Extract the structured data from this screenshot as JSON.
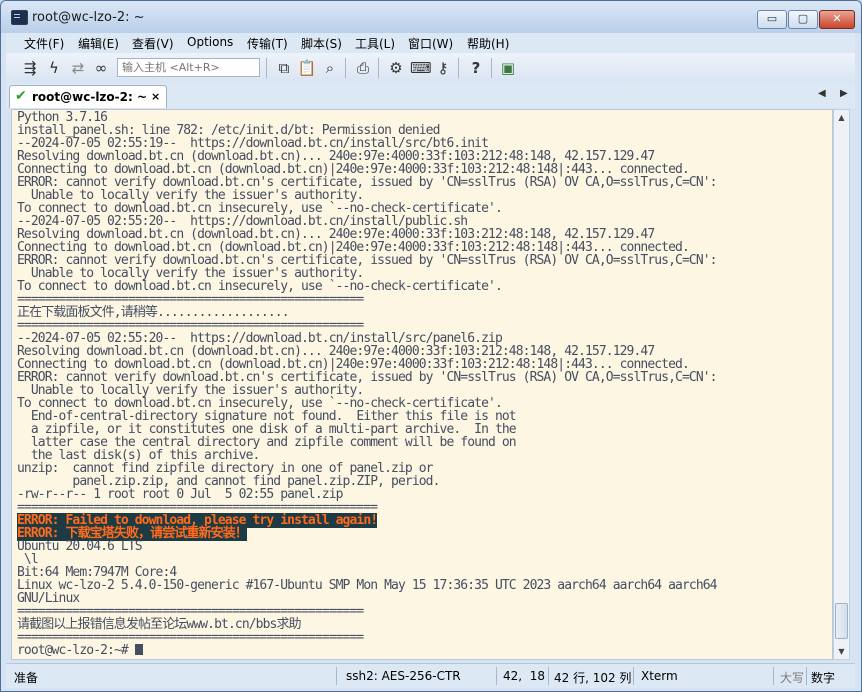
{
  "window": {
    "title": "root@wc-lzo-2: ~",
    "controls": {
      "minimize": "▭",
      "maximize": "▢",
      "close": "✕"
    }
  },
  "menubar": {
    "items": [
      "文件(F)",
      "编辑(E)",
      "查看(V)",
      "Options",
      "传输(T)",
      "脚本(S)",
      "工具(L)",
      "窗口(W)",
      "帮助(H)"
    ]
  },
  "toolbar": {
    "host_placeholder": "输入主机 <Alt+R>",
    "icons": [
      "connect-icon",
      "lightning-icon",
      "reconnect-icon",
      "link-icon",
      "copy-icon",
      "paste-icon",
      "find-icon",
      "print-icon",
      "settings-icon",
      "keymap-icon",
      "key-icon",
      "help-icon",
      "sftp-icon"
    ]
  },
  "tab": {
    "label": "root@wc-lzo-2: ~",
    "close": "×",
    "nav_prev": "◀",
    "nav_next": "▶"
  },
  "terminal": {
    "lines": [
      "Python 3.7.16",
      "install_panel.sh: line 782: /etc/init.d/bt: Permission denied",
      "--2024-07-05 02:55:19--  https://download.bt.cn/install/src/bt6.init",
      "Resolving download.bt.cn (download.bt.cn)... 240e:97e:4000:33f:103:212:48:148, 42.157.129.47",
      "Connecting to download.bt.cn (download.bt.cn)|240e:97e:4000:33f:103:212:48:148|:443... connected.",
      "ERROR: cannot verify download.bt.cn's certificate, issued by 'CN=sslTrus (RSA) OV CA,O=sslTrus,C=CN':",
      "  Unable to locally verify the issuer's authority.",
      "To connect to download.bt.cn insecurely, use `--no-check-certificate'.",
      "--2024-07-05 02:55:20--  https://download.bt.cn/install/public.sh",
      "Resolving download.bt.cn (download.bt.cn)... 240e:97e:4000:33f:103:212:48:148, 42.157.129.47",
      "Connecting to download.bt.cn (download.bt.cn)|240e:97e:4000:33f:103:212:48:148|:443... connected.",
      "ERROR: cannot verify download.bt.cn's certificate, issued by 'CN=sslTrus (RSA) OV CA,O=sslTrus,C=CN':",
      "  Unable to locally verify the issuer's authority.",
      "To connect to download.bt.cn insecurely, use `--no-check-certificate'.",
      "==================================================",
      "正在下载面板文件,请稍等...................",
      "==================================================",
      "--2024-07-05 02:55:20--  https://download.bt.cn/install/src/panel6.zip",
      "Resolving download.bt.cn (download.bt.cn)... 240e:97e:4000:33f:103:212:48:148, 42.157.129.47",
      "Connecting to download.bt.cn (download.bt.cn)|240e:97e:4000:33f:103:212:48:148|:443... connected.",
      "ERROR: cannot verify download.bt.cn's certificate, issued by 'CN=sslTrus (RSA) OV CA,O=sslTrus,C=CN':",
      "  Unable to locally verify the issuer's authority.",
      "To connect to download.bt.cn insecurely, use `--no-check-certificate'.",
      "  End-of-central-directory signature not found.  Either this file is not",
      "  a zipfile, or it constitutes one disk of a multi-part archive.  In the",
      "  latter case the central directory and zipfile comment will be found on",
      "  the last disk(s) of this archive.",
      "unzip:  cannot find zipfile directory in one of panel.zip or",
      "        panel.zip.zip, and cannot find panel.zip.ZIP, period.",
      "-rw-r--r-- 1 root root 0 Jul  5 02:55 panel.zip",
      "====================================================",
      "ERROR: Failed to download, please try install again!",
      "ERROR: 下载宝塔失败，请尝试重新安装！",
      "Ubuntu 20.04.6 LTS",
      " \\l",
      "Bit:64 Mem:7947M Core:4",
      "Linux wc-lzo-2 5.4.0-150-generic #167-Ubuntu SMP Mon May 15 17:36:35 UTC 2023 aarch64 aarch64 aarch64",
      "GNU/Linux",
      "==================================================",
      "请截图以上报错信息发帖至论坛www.bt.cn/bbs求助",
      "==================================================",
      "root@wc-lzo-2:~# "
    ],
    "error_line_indices": [
      31,
      32
    ]
  },
  "scrollbar": {
    "up": "▲",
    "down": "▼"
  },
  "statusbar": {
    "ready": "准备",
    "protocol": "ssh2: AES-256-CTR",
    "cursor_pos": "42,  18",
    "rows_cols": "42 行, 102 列",
    "term_type": "Xterm",
    "caps": "大写",
    "num": "数字"
  }
}
